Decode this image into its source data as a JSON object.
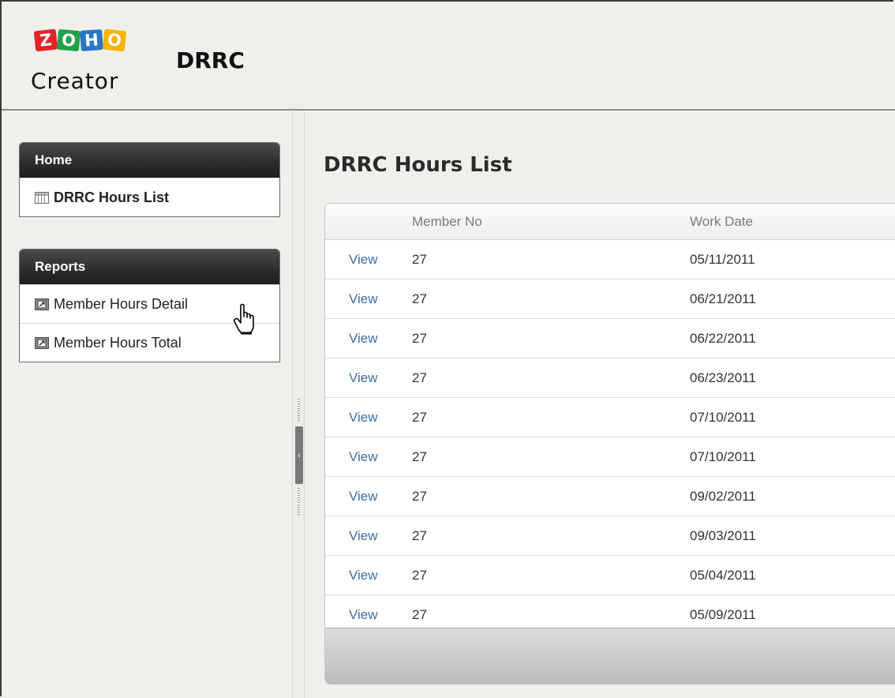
{
  "brand": {
    "logo_letters": [
      "Z",
      "O",
      "H",
      "O"
    ],
    "logo_subtitle": "Creator",
    "colors": {
      "z": "#e42527",
      "o1": "#23a04a",
      "h": "#2a77c4",
      "o2": "#f4b400"
    }
  },
  "app": {
    "title": "DRRC"
  },
  "sidebar": {
    "home": {
      "title": "Home",
      "items": [
        {
          "label": "DRRC Hours List",
          "icon": "table-icon"
        }
      ]
    },
    "reports": {
      "title": "Reports",
      "items": [
        {
          "label": "Member Hours Detail",
          "icon": "report-icon"
        },
        {
          "label": "Member Hours Total",
          "icon": "report-icon"
        }
      ]
    }
  },
  "main": {
    "title": "DRRC Hours List",
    "columns": {
      "member_no": "Member No",
      "work_date": "Work Date"
    },
    "rows": [
      {
        "action": "View",
        "member_no": "27",
        "work_date": "05/11/2011"
      },
      {
        "action": "View",
        "member_no": "27",
        "work_date": "06/21/2011"
      },
      {
        "action": "View",
        "member_no": "27",
        "work_date": "06/22/2011"
      },
      {
        "action": "View",
        "member_no": "27",
        "work_date": "06/23/2011"
      },
      {
        "action": "View",
        "member_no": "27",
        "work_date": "07/10/2011"
      },
      {
        "action": "View",
        "member_no": "27",
        "work_date": "07/10/2011"
      },
      {
        "action": "View",
        "member_no": "27",
        "work_date": "09/02/2011"
      },
      {
        "action": "View",
        "member_no": "27",
        "work_date": "09/03/2011"
      },
      {
        "action": "View",
        "member_no": "27",
        "work_date": "05/04/2011"
      },
      {
        "action": "View",
        "member_no": "27",
        "work_date": "05/09/2011"
      }
    ]
  },
  "splitter": {
    "collapse_glyph": "‹"
  },
  "colors": {
    "link": "#3b6ea8",
    "panel_header": "#2c2c2c",
    "background": "#f1efeb"
  }
}
